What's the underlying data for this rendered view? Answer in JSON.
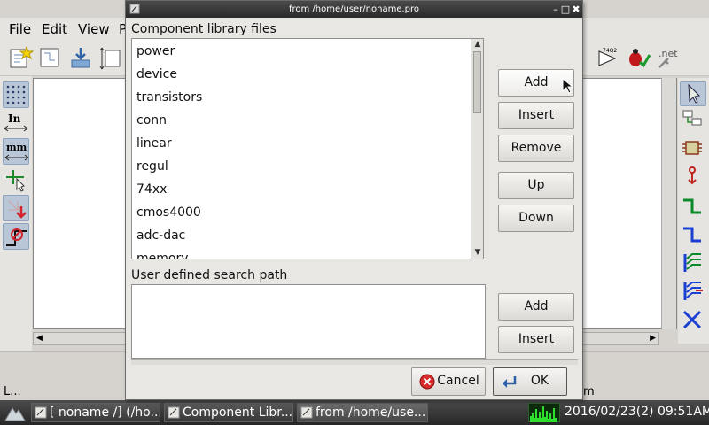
{
  "app": {
    "menu": [
      "File",
      "Edit",
      "View",
      "P"
    ],
    "toolbar_text": {
      "chip_label": "74Q2",
      "net_label": ".net"
    },
    "status": {
      "left": "L...",
      "right": "m"
    }
  },
  "left_toolbar": {
    "inch_label": "In",
    "mm_label": "mm"
  },
  "dialog": {
    "title": "from /home/user/noname.pro",
    "window_controls": {
      "minimize": "–",
      "maximize": "□",
      "close": "✖"
    },
    "library_section_label": "Component library files",
    "libraries": [
      "power",
      "device",
      "transistors",
      "conn",
      "linear",
      "regul",
      "74xx",
      "cmos4000",
      "adc-dac",
      "memory"
    ],
    "library_buttons": {
      "add": "Add",
      "insert": "Insert",
      "remove": "Remove",
      "up": "Up",
      "down": "Down"
    },
    "search_path_label": "User defined search path",
    "path_buttons": {
      "add": "Add",
      "insert": "Insert"
    },
    "cancel_label": "Cancel",
    "ok_label": "OK"
  },
  "taskbar": {
    "tasks": [
      "[ noname /] (/ho...",
      "Component Libr...",
      "from /home/use..."
    ],
    "clock": "2016/02/23(2) 09:51AM"
  },
  "colors": {
    "title_bar": "#2e2e2e",
    "taskbar": "#333333",
    "cancel_icon": "#d52b2b",
    "wire_green": "#0a8a2a",
    "bus_blue": "#1b3fd1"
  }
}
